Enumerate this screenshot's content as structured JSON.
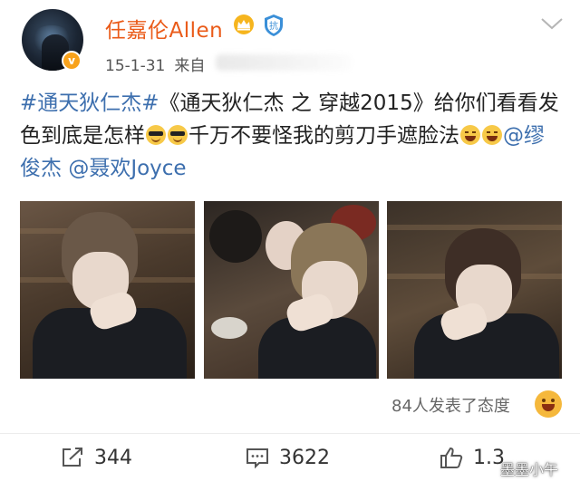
{
  "user": {
    "name": "任嘉伦Allen",
    "verified_mark": "v",
    "timestamp": "15-1-31",
    "source_prefix": "来自"
  },
  "post": {
    "hashtag": "#通天狄仁杰#",
    "text_part1": "《通天狄仁杰 之 穿越2015》给你们看看发色到底是怎样",
    "text_part2": "千万不要怪我的剪刀手遮脸法",
    "mention1": "@缪俊杰",
    "mention2": "@聂欢Joyce",
    "emoji_names": [
      "cool-sunglasses-emoji",
      "laughing-tears-emoji"
    ]
  },
  "photos": [
    "selfie-photo-1",
    "selfie-photo-2",
    "selfie-photo-3"
  ],
  "reactions": {
    "text": "84人发表了态度"
  },
  "actions": {
    "shares": "344",
    "comments": "3622",
    "likes": "1.3"
  },
  "watermark": "墨墨小午",
  "colors": {
    "username": "#ea5b19",
    "link": "#3d6fae",
    "verified_badge": "#f8a21b"
  },
  "icons": [
    "crown-icon",
    "shield-icon",
    "chevron-down-icon",
    "share-icon",
    "comment-icon",
    "like-icon",
    "smiley-icon"
  ]
}
